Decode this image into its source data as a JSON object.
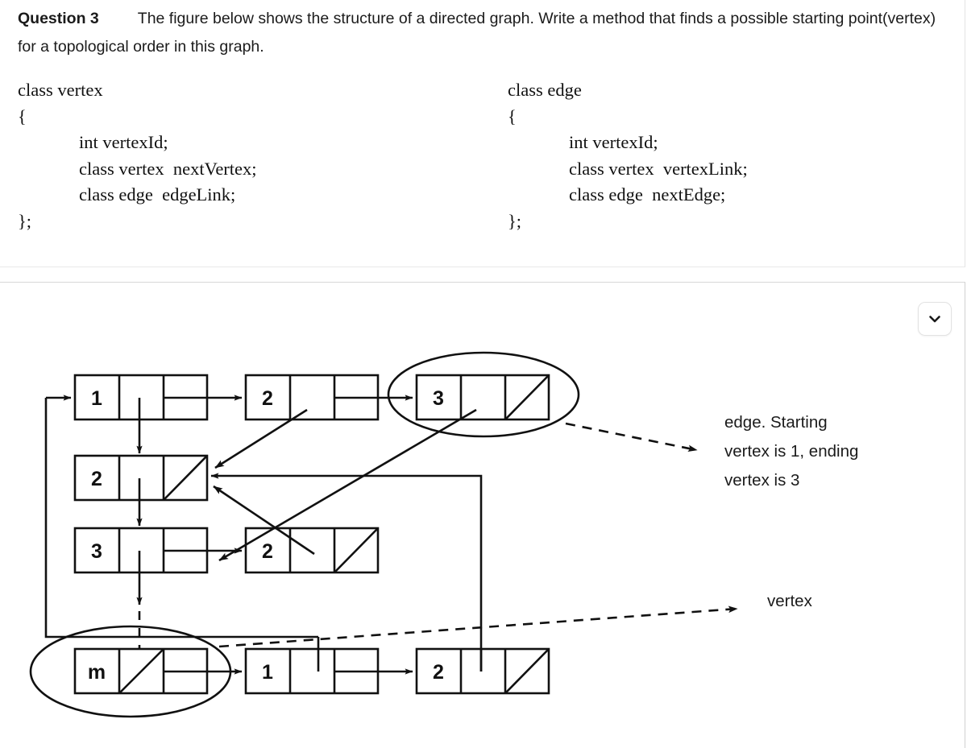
{
  "question": {
    "label": "Question 3",
    "text": "The figure below shows the structure of a directed graph. Write a method that finds  a possible starting point(vertex)  for a topological order in this graph."
  },
  "code_blocks": [
    {
      "name": "class-vertex",
      "lines": [
        "class vertex",
        "{",
        "int vertexId;",
        "class vertex  nextVertex;",
        "class edge  edgeLink;",
        "};"
      ],
      "header": "class vertex",
      "open_brace": "{",
      "members": [
        "int vertexId;",
        "class vertex  nextVertex;",
        "class edge  edgeLink;"
      ],
      "close_brace": "};"
    },
    {
      "name": "class-edge",
      "header": "class edge",
      "open_brace": "{",
      "members": [
        "int vertexId;",
        "class vertex  vertexLink;",
        "class edge  nextEdge;"
      ],
      "close_brace": "};"
    }
  ],
  "figure": {
    "collapse_icon": "chevron-down-icon",
    "annotations": [
      {
        "name": "edge-annotation",
        "lines": [
          "edge.  Starting",
          "vertex is 1, ending",
          "vertex is 3"
        ]
      },
      {
        "name": "vertex-annotation",
        "lines": [
          "vertex"
        ]
      }
    ],
    "vertex_list": {
      "name": "vertex-chain",
      "labels": [
        "1",
        "2",
        "3",
        "m"
      ]
    },
    "edge_lists": {
      "vertex_1_edges": [
        "2",
        "3"
      ],
      "vertex_2_edges": [],
      "vertex_3_edges": [
        "2"
      ],
      "vertex_m_edges": []
    },
    "nodes": [
      {
        "name": "vertex-node-1",
        "label": "1",
        "row": "top",
        "null_cell": "none"
      },
      {
        "name": "edge-node-2",
        "label": "2",
        "row": "top",
        "null_cell": "none"
      },
      {
        "name": "edge-node-3",
        "label": "3",
        "row": "top",
        "null_cell": "third",
        "circled": true
      },
      {
        "name": "vertex-node-2",
        "label": "2",
        "row": "second",
        "null_cell": "third"
      },
      {
        "name": "vertex-node-3",
        "label": "3",
        "row": "third",
        "null_cell": "none"
      },
      {
        "name": "edge-node-2b",
        "label": "2",
        "row": "third",
        "null_cell": "third"
      },
      {
        "name": "vertex-node-m",
        "label": "m",
        "row": "bottom",
        "null_cell": "second",
        "circled": true
      },
      {
        "name": "edge-node-1",
        "label": "1",
        "row": "bottom",
        "null_cell": "none"
      },
      {
        "name": "edge-node-2c",
        "label": "2",
        "row": "bottom",
        "null_cell": "third"
      }
    ],
    "colors": {
      "stroke": "#111111",
      "background": "#ffffff",
      "panel_border": "#e0e0e0"
    }
  }
}
